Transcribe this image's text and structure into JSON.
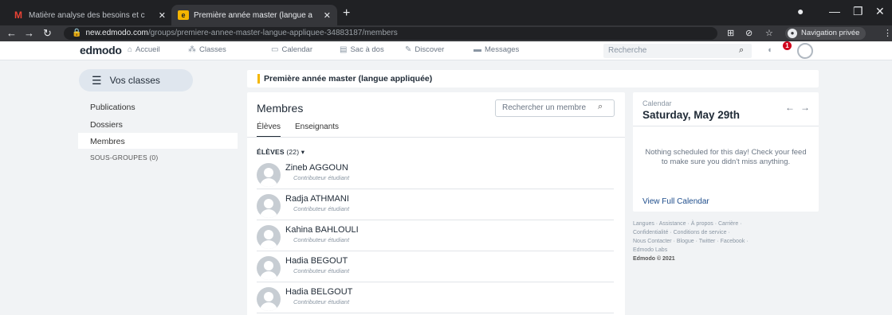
{
  "browser": {
    "tabs": [
      {
        "title": "Matière analyse des besoins et c",
        "active": false
      },
      {
        "title": "Première année master (langue a",
        "active": true
      }
    ],
    "new_tab": "+",
    "url_host": "new.edmodo.com",
    "url_path": "/groups/premiere-annee-master-langue-appliquee-34883187/members",
    "incognito_label": "Navigation privée"
  },
  "nav": {
    "logo": "edmodo",
    "items": [
      {
        "label": "Accueil",
        "icon": "home-icon"
      },
      {
        "label": "Classes",
        "icon": "classes-icon"
      },
      {
        "label": "Calendar",
        "icon": "calendar-icon"
      },
      {
        "label": "Sac à dos",
        "icon": "backpack-icon"
      },
      {
        "label": "Discover",
        "icon": "discover-icon"
      },
      {
        "label": "Messages",
        "icon": "messages-icon"
      }
    ],
    "search_placeholder": "Recherche",
    "notification_count": "1"
  },
  "sidebar": {
    "vos_classes": "Vos classes",
    "links": [
      "Publications",
      "Dossiers",
      "Membres"
    ],
    "active": "Membres",
    "subgroups": "SOUS-GROUPES (0)"
  },
  "group": {
    "title": "Première année master (langue appliquée)"
  },
  "members": {
    "heading": "Membres",
    "search_placeholder": "Rechercher un membre",
    "tabs": [
      "Élèves",
      "Enseignants"
    ],
    "active_tab": "Élèves",
    "section_label": "ÉLÈVES",
    "section_count": "(22)",
    "list": [
      {
        "name": "Zineb AGGOUN",
        "role": "Contributeur étudiant"
      },
      {
        "name": "Radja ATHMANI",
        "role": "Contributeur étudiant"
      },
      {
        "name": "Kahina BAHLOULI",
        "role": "Contributeur étudiant"
      },
      {
        "name": "Hadia BEGOUT",
        "role": "Contributeur étudiant"
      },
      {
        "name": "Hadia BELGOUT",
        "role": "Contributeur étudiant"
      }
    ]
  },
  "calendar": {
    "label": "Calendar",
    "date": "Saturday, May 29th",
    "empty_message": "Nothing scheduled for this day! Check your feed to make sure you didn't miss anything.",
    "view_link": "View Full Calendar"
  },
  "footer": {
    "lines": [
      "Langues · Assistance · À propos · Carrière ·",
      "Confidentialité · Conditions de service ·",
      "Nous Contacter · Blogue · Twitter · Facebook ·",
      "Edmodo Labs"
    ],
    "copyright": "Edmodo © 2021"
  },
  "colors": {
    "accent_yellow": "#f5b700",
    "chrome_dark": "#202124",
    "link_blue": "#1f4e8c",
    "badge_red": "#d0021b"
  }
}
